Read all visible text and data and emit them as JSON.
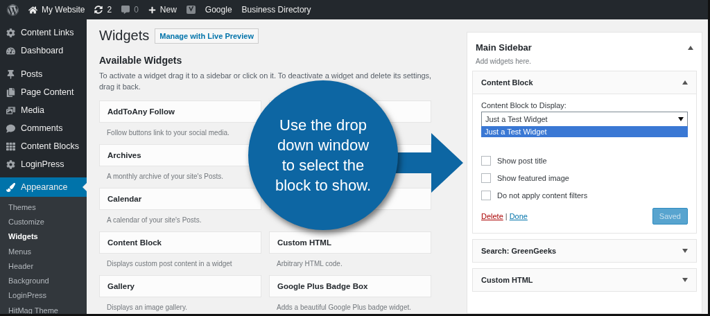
{
  "admin_bar": {
    "items": [
      {
        "kind": "logo"
      },
      {
        "kind": "home",
        "label": "My Website"
      },
      {
        "kind": "updates",
        "label": "2"
      },
      {
        "kind": "comments",
        "label": "0"
      },
      {
        "kind": "new",
        "label": "New"
      },
      {
        "kind": "seo"
      },
      {
        "kind": "text",
        "label": "Google"
      },
      {
        "kind": "text",
        "label": "Business Directory"
      }
    ]
  },
  "menu": {
    "groups": [
      {
        "items": [
          {
            "kind": "links",
            "label": "Content Links",
            "selected": false
          },
          {
            "kind": "dashboard",
            "label": "Dashboard",
            "selected": false
          }
        ]
      },
      {
        "items": [
          {
            "kind": "posts",
            "label": "Posts",
            "selected": false
          },
          {
            "kind": "pages",
            "label": "Page Content",
            "selected": false
          },
          {
            "kind": "media",
            "label": "Media",
            "selected": false
          },
          {
            "kind": "comments",
            "label": "Comments",
            "selected": false
          },
          {
            "kind": "blocks",
            "label": "Content Blocks",
            "selected": false
          },
          {
            "kind": "plugin",
            "label": "LoginPress",
            "selected": false
          },
          {
            "kind": "appearance",
            "label": "Appearance",
            "selected": true
          }
        ]
      }
    ],
    "submenu": [
      {
        "label": "Themes",
        "selected": false
      },
      {
        "label": "Customize",
        "selected": false
      },
      {
        "label": "Widgets",
        "selected": true
      },
      {
        "label": "Menus",
        "selected": false
      },
      {
        "label": "Header",
        "selected": false
      },
      {
        "label": "Background",
        "selected": false
      },
      {
        "label": "LoginPress",
        "selected": false
      },
      {
        "label": "HitMag Theme",
        "selected": false
      }
    ]
  },
  "page": {
    "title": "Widgets",
    "action": "Manage with Live Preview"
  },
  "available": {
    "heading": "Available Widgets",
    "intro": "To activate a widget drag it to a sidebar or click on it. To deactivate a widget and delete its settings, drag it back.",
    "widgets": [
      {
        "name": "AddToAny Follow",
        "description": "Follow buttons link to your social media."
      },
      {
        "covered": true
      },
      {
        "name": "Archives",
        "description": "A monthly archive of your site's Posts."
      },
      {
        "covered": true
      },
      {
        "name": "Calendar",
        "description": "A calendar of your site's Posts."
      },
      {
        "covered": true
      },
      {
        "name": "Content Block",
        "description": "Displays custom post content in a widget"
      },
      {
        "name": "Custom HTML",
        "description": "Arbitrary HTML code."
      },
      {
        "name": "Gallery",
        "description": "Displays an image gallery."
      },
      {
        "name": "Google Plus Badge Box",
        "description": "Adds a beautiful Google Plus badge widget."
      }
    ]
  },
  "sidebar_area": {
    "title": "Main Sidebar",
    "expanded": true,
    "description": "Add widgets here.",
    "widgets": [
      {
        "title": "Content Block",
        "expanded": true,
        "select_label": "Content Block to Display:",
        "select_value": "Just a Test Widget",
        "select_open": true,
        "options": [
          {
            "label": "Just a Test Widget",
            "selected": true
          }
        ],
        "checkboxes": [
          {
            "label": "Show post title",
            "checked": false
          },
          {
            "label": "Show featured image",
            "checked": false
          },
          {
            "label": "Do not apply content filters",
            "checked": false
          }
        ],
        "delete_link": "Delete",
        "separator": "|",
        "done_link": "Done",
        "save_button": {
          "label": "Saved",
          "disabled": true
        }
      },
      {
        "title": "Search: GreenGeeks",
        "expanded": false
      },
      {
        "title": "Custom HTML",
        "expanded": false
      }
    ]
  },
  "callout": {
    "text": "Use the drop down window to select the block to show."
  }
}
